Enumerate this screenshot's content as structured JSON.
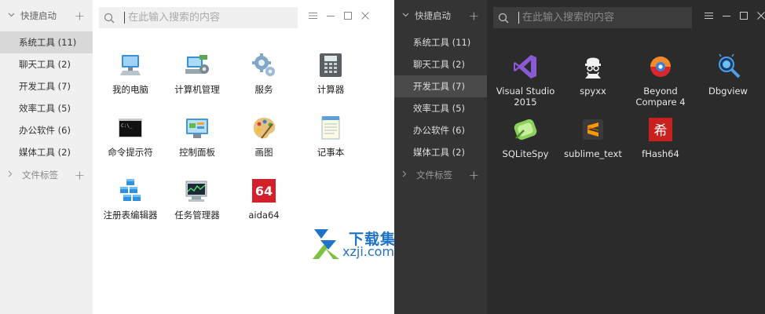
{
  "placeholder": "在此输入搜索的内容",
  "light": {
    "section_head": "快捷启动",
    "categories": [
      "系统工具 (11)",
      "聊天工具 (2)",
      "开发工具 (7)",
      "效率工具 (5)",
      "办公软件 (6)",
      "媒体工具 (2)"
    ],
    "active_index": 0,
    "tags_label": "文件标签",
    "apps": [
      {
        "label": "我的电脑",
        "icon": "computer-icon"
      },
      {
        "label": "计算机管理",
        "icon": "computer-management-icon"
      },
      {
        "label": "服务",
        "icon": "services-gear-icon"
      },
      {
        "label": "计算器",
        "icon": "calculator-icon"
      },
      {
        "label": "命令提示符",
        "icon": "command-prompt-icon"
      },
      {
        "label": "控制面板",
        "icon": "control-panel-icon"
      },
      {
        "label": "画图",
        "icon": "paint-palette-icon"
      },
      {
        "label": "记事本",
        "icon": "notepad-icon"
      },
      {
        "label": "注册表编辑器",
        "icon": "registry-editor-icon"
      },
      {
        "label": "任务管理器",
        "icon": "task-manager-icon"
      },
      {
        "label": "aida64",
        "icon": "aida64-icon"
      }
    ]
  },
  "dark": {
    "section_head": "快捷启动",
    "categories": [
      "系统工具 (11)",
      "聊天工具 (2)",
      "开发工具 (7)",
      "效率工具 (5)",
      "办公软件 (6)",
      "媒体工具 (2)"
    ],
    "active_index": 2,
    "tags_label": "文件标签",
    "apps": [
      {
        "label": "Visual Studio\n2015",
        "icon": "visual-studio-icon"
      },
      {
        "label": "spyxx",
        "icon": "spyxx-icon"
      },
      {
        "label": "Beyond\nCompare 4",
        "icon": "beyond-compare-icon"
      },
      {
        "label": "Dbgview",
        "icon": "dbgview-icon"
      },
      {
        "label": "SQLiteSpy",
        "icon": "sqlitespy-icon"
      },
      {
        "label": "sublime_text",
        "icon": "sublime-text-icon"
      },
      {
        "label": "fHash64",
        "icon": "fhash64-icon"
      }
    ]
  },
  "watermark": {
    "line1": "下载集",
    "line2": "xzji.com"
  },
  "colors": {
    "accent_blue": "#1e74c8",
    "dark_bg": "#2b2b2b",
    "light_sidebar": "#f0f0f0"
  }
}
